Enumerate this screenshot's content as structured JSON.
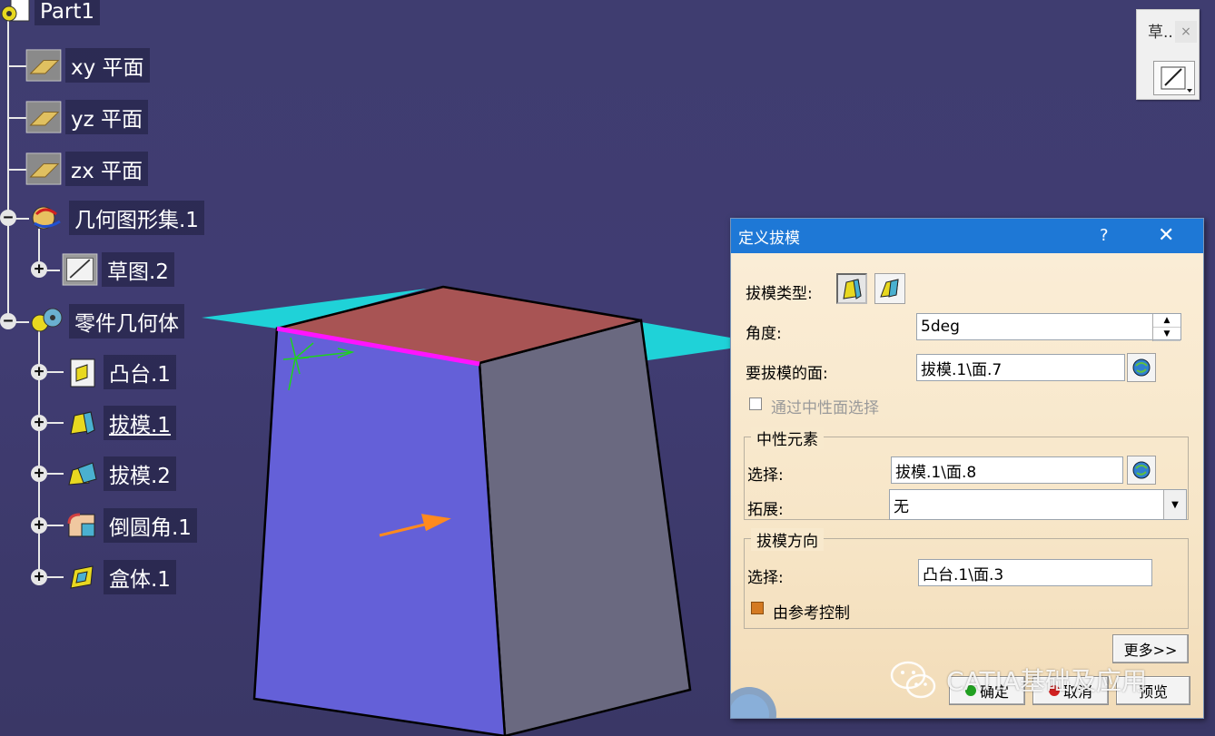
{
  "tree": {
    "root": "Part1",
    "items": [
      {
        "label": "xy 平面"
      },
      {
        "label": "yz 平面"
      },
      {
        "label": "zx 平面"
      },
      {
        "label": "几何图形集.1"
      },
      {
        "label": "草图.2"
      },
      {
        "label": "零件几何体"
      },
      {
        "label": "凸台.1"
      },
      {
        "label": "拔模.1"
      },
      {
        "label": "拔模.2"
      },
      {
        "label": "倒圆角.1"
      },
      {
        "label": "盒体.1"
      }
    ]
  },
  "toolbar": {
    "title": "草..",
    "close": "×"
  },
  "dialog": {
    "title": "定义拔模",
    "help": "?",
    "close": "✕",
    "draft_type_label": "拔模类型:",
    "angle_label": "角度:",
    "angle_value": "5deg",
    "faces_label": "要拔模的面:",
    "faces_value": "拔模.1\\面.7",
    "neutral_select_checkbox": "通过中性面选择",
    "neutral_group": "中性元素",
    "neutral_select_label": "选择:",
    "neutral_select_value": "拔模.1\\面.8",
    "propagation_label": "拓展:",
    "propagation_value": "无",
    "direction_group": "拔模方向",
    "direction_select_label": "选择:",
    "direction_select_value": "凸台.1\\面.3",
    "controlled_by_ref": "由参考控制",
    "more_button": "更多>>",
    "ok_button": "确定",
    "cancel_button": "取消",
    "preview_button": "预览"
  },
  "watermark": "CATIA基础及应用",
  "colors": {
    "background": "#403c72",
    "front_face": "#6460d8",
    "side_face": "#6a6980",
    "top_face": "#a85454",
    "neutral_plane": "#1fd2d8",
    "neutral_edge": "#ff14ff",
    "title_bar": "#1e78d6"
  }
}
